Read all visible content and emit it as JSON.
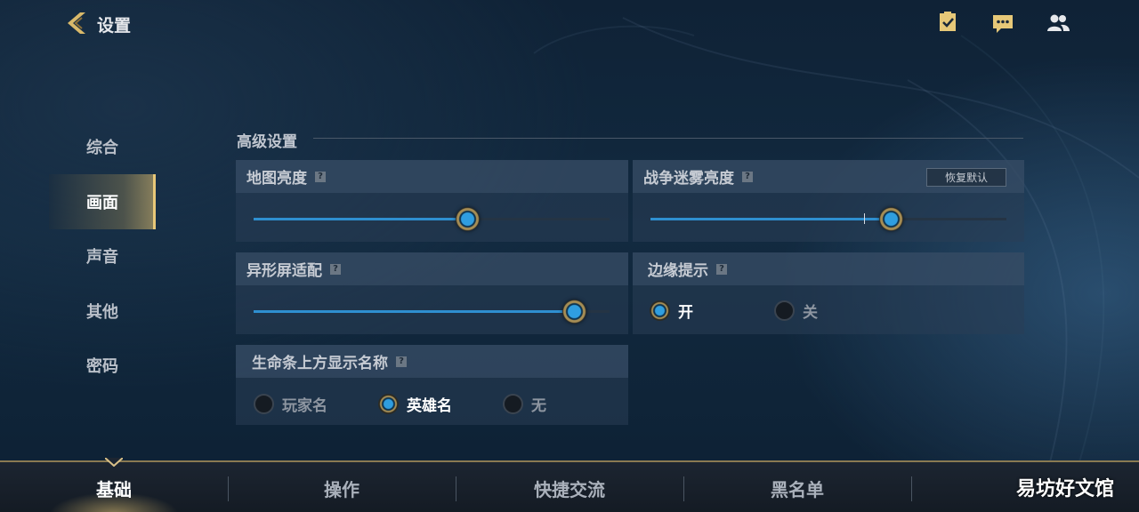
{
  "header": {
    "title": "设置",
    "icons": [
      "task-checklist-icon",
      "chat-icon",
      "friends-icon"
    ]
  },
  "sidebar": {
    "items": [
      {
        "label": "综合",
        "active": false
      },
      {
        "label": "画面",
        "active": true
      },
      {
        "label": "声音",
        "active": false
      },
      {
        "label": "其他",
        "active": false
      },
      {
        "label": "密码",
        "active": false
      }
    ]
  },
  "section": {
    "title": "高级设置"
  },
  "panels": {
    "map_brightness": {
      "title": "地图亮度",
      "help": "?",
      "value": 0.6
    },
    "fog_brightness": {
      "title": "战争迷雾亮度",
      "help": "?",
      "reset_label": "恢复默认",
      "value": 0.675,
      "default_mark": 0.6
    },
    "notch_adapt": {
      "title": "异形屏适配",
      "help": "?",
      "value": 0.9
    },
    "edge_hint": {
      "title": "边缘提示",
      "help": "?",
      "options": [
        {
          "label": "开",
          "checked": true
        },
        {
          "label": "关",
          "checked": false
        }
      ]
    },
    "name_above_hp": {
      "title": "生命条上方显示名称",
      "help": "?",
      "options": [
        {
          "label": "玩家名",
          "checked": false
        },
        {
          "label": "英雄名",
          "checked": true
        },
        {
          "label": "无",
          "checked": false
        }
      ]
    }
  },
  "bottom_tabs": [
    {
      "label": "基础",
      "active": true
    },
    {
      "label": "操作",
      "active": false
    },
    {
      "label": "快捷交流",
      "active": false
    },
    {
      "label": "黑名单",
      "active": false
    },
    {
      "label": "",
      "active": false
    }
  ],
  "watermark": "易坊好文馆",
  "colors": {
    "accent_blue": "#2e8fd0",
    "gold": "#e8c878",
    "background": "#122a40"
  }
}
